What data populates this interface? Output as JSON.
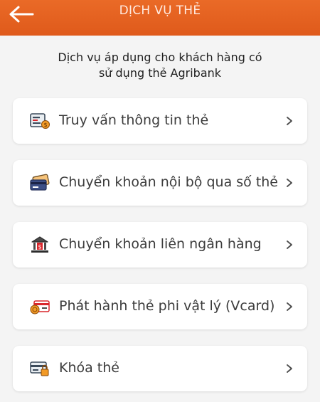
{
  "header": {
    "title": "DỊCH VỤ THẺ",
    "back_icon": "arrow-left-icon"
  },
  "intro": {
    "line1": "Dịch vụ áp dụng cho khách hàng có",
    "line2": "sử dụng thẻ Agribank"
  },
  "colors": {
    "header": "#e3611f",
    "background": "#f4f4f4",
    "card": "#ffffff",
    "accent_red": "#d9262c",
    "accent_orange": "#f29a26"
  },
  "menu": [
    {
      "label": "Truy vấn thông tin thẻ",
      "icon": "card-info-icon"
    },
    {
      "label": "Chuyển khoản nội bộ qua số thẻ",
      "icon": "card-transfer-icon"
    },
    {
      "label": "Chuyển khoản liên ngân hàng",
      "icon": "bank-icon"
    },
    {
      "label": "Phát hành thẻ phi vật lý (Vcard)",
      "icon": "virtual-card-icon"
    },
    {
      "label": "Khóa thẻ",
      "icon": "lock-card-icon"
    }
  ]
}
